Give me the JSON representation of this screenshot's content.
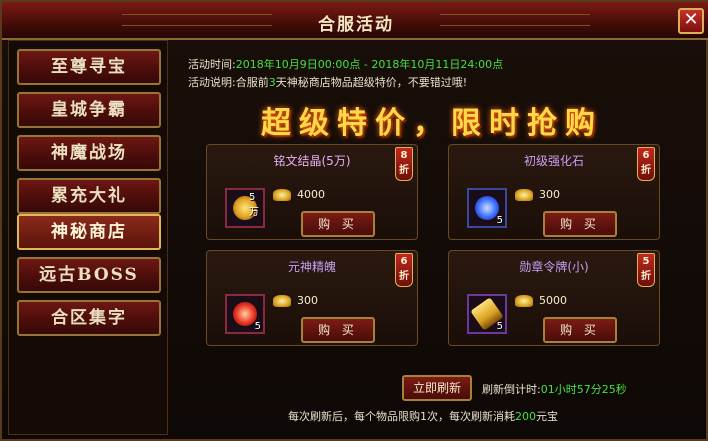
{
  "window": {
    "title": "合服活动",
    "close_label": "✕"
  },
  "sidebar": {
    "items": [
      {
        "label": "至尊寻宝"
      },
      {
        "label": "皇城争霸"
      },
      {
        "label": "神魔战场"
      },
      {
        "label": "累充大礼"
      },
      {
        "label": "神秘商店"
      },
      {
        "label": "远古BOSS"
      },
      {
        "label": "合区集字"
      }
    ],
    "active": "神秘商店"
  },
  "info": {
    "time_label": "活动时间:",
    "time_start": "2018年10月9日00:00点",
    "time_sep": " - ",
    "time_end": "2018年10月11日24:00点",
    "desc_label": "活动说明:",
    "desc_pre": "合服前",
    "desc_days": "3",
    "desc_post": "天神秘商店物品超级特价，不要错过哦!"
  },
  "banner": "超级特价，限时抢购",
  "shop": [
    {
      "name": "铭文结晶(5万)",
      "discount": "8折",
      "qty_label": "5万",
      "qty": "",
      "price": "4000",
      "buy_label": "购 买",
      "icon_color": "#e0a020",
      "name_color": "#e8b0f0"
    },
    {
      "name": "初级强化石",
      "discount": "6折",
      "qty_label": "",
      "qty": "5",
      "price": "300",
      "buy_label": "购 买",
      "icon_color": "#3a6aff",
      "name_color": "#c8a0f0"
    },
    {
      "name": "元神精魄",
      "discount": "6折",
      "qty_label": "",
      "qty": "5",
      "price": "300",
      "buy_label": "购 买",
      "icon_color": "#e83020",
      "name_color": "#c8a0f0"
    },
    {
      "name": "勋章令牌(小)",
      "discount": "5折",
      "qty_label": "",
      "qty": "5",
      "price": "5000",
      "buy_label": "购 买",
      "icon_color": "#d9a321",
      "name_color": "#c8a0f0"
    }
  ],
  "footer": {
    "refresh_label": "立即刷新",
    "countdown_label": "刷新倒计时:",
    "countdown_value": "01小时57分25秒",
    "note_pre": "每次刷新后，每个物品限购1次，每次刷新消耗",
    "note_cost": "200",
    "note_post": "元宝"
  }
}
